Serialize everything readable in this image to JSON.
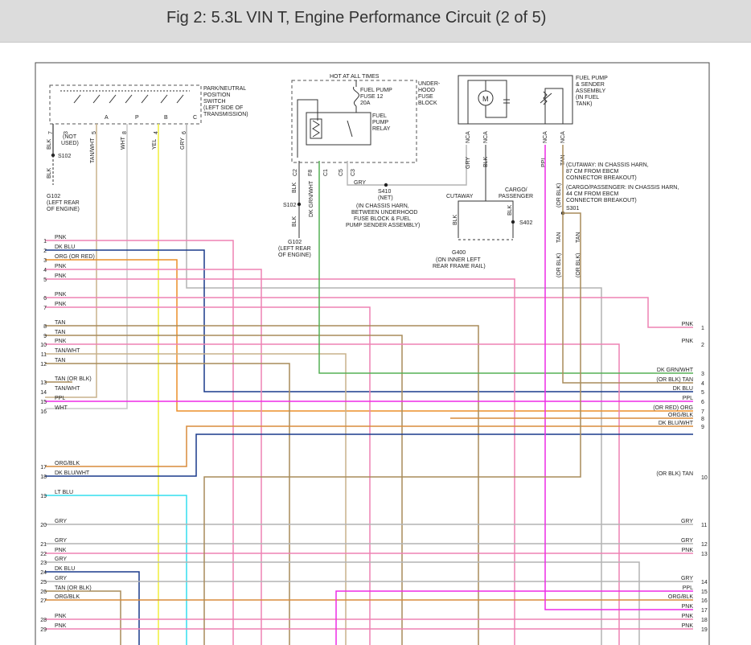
{
  "header": {
    "title": "Fig 2: 5.3L VIN T, Engine Performance Circuit (2 of 5)"
  },
  "colors": {
    "PNK": "#ee82b4",
    "DKBLU": "#1a3a8c",
    "ORG": "#ec8f2a",
    "TAN": "#a88c5a",
    "TANWHT": "#c8b28c",
    "PPL": "#ee2ce6",
    "WHT": "#c8c8c8",
    "GRY": "#b4b4b4",
    "YEL": "#f0ee3a",
    "DKGRNWHT": "#55b055",
    "LTBLU": "#33ddee",
    "ORGBLK": "#d88b3c",
    "BLK": "#333333",
    "BOX": "#4a4a4a"
  },
  "park_switch": {
    "title_lines": [
      "PARK/NEUTRAL",
      "POSITION",
      "SWITCH",
      "(LEFT SIDE OF",
      "TRANSMISSION)"
    ],
    "positions": [
      "A",
      "P",
      "B",
      "C"
    ],
    "pins": [
      "7",
      "3",
      "5",
      "8",
      "4",
      "6"
    ],
    "wires": [
      "BLK",
      "(NOT USED)",
      "TAN/WHT",
      "WHT",
      "YEL",
      "GRY"
    ],
    "not_used": [
      "(NOT",
      "USED)"
    ]
  },
  "ground_left": {
    "splice": "S102",
    "wire": "BLK",
    "ground": "G102",
    "ground_lines": [
      "(LEFT REAR",
      "OF ENGINE)"
    ]
  },
  "fuse_block": {
    "hot_label": "HOT AT ALL TIMES",
    "block_lines": [
      "UNDER-",
      "HOOD",
      "FUSE",
      "BLOCK"
    ],
    "fuse_lines": [
      "FUEL PUMP",
      "FUSE 12",
      "20A"
    ],
    "relay_lines": [
      "FUEL",
      "PUMP",
      "RELAY"
    ],
    "pins": [
      "C2",
      "F8",
      "C1",
      "C5",
      "C3"
    ],
    "wire_blk": "BLK",
    "wire_dkgrn": "DK GRN/WHT",
    "wire_gry": "GRY",
    "splice_s102": "S102",
    "wire_blk2": "BLK",
    "ground": "G102",
    "ground_lines": [
      "(LEFT REAR",
      "OF ENGINE)"
    ]
  },
  "s410": {
    "label": "S410",
    "sub": "(NET)",
    "lines": [
      "(IN CHASSIS HARN,",
      "BETWEEN UNDERHOOD",
      "FUSE BLOCK & FUEL",
      "PUMP SENDER ASSEMBLY)"
    ]
  },
  "fuel_pump": {
    "title_lines": [
      "FUEL PUMP",
      "& SENDER",
      "ASSEMBLY",
      "(IN FUEL",
      "TANK)"
    ],
    "motor": "M",
    "pins": [
      "NCA",
      "NCA",
      "NCA",
      "NCA"
    ],
    "wires": [
      "GRY",
      "BLK",
      "PPL",
      "TAN"
    ]
  },
  "ground_g400": {
    "cutaway": "CUTAWAY",
    "cargo_lines": [
      "CARGO/",
      "PASSENGER"
    ],
    "wire1": "BLK",
    "wire2": "BLK",
    "splice": "S402",
    "ground": "G400",
    "ground_lines": [
      "(ON INNER LEFT",
      "REAR FRAME RAIL)"
    ]
  },
  "s301": {
    "lines": [
      "(CUTAWAY: IN CHASSIS HARN,",
      "87 CM FROM EBCM",
      "CONNECTOR BREAKOUT)",
      "(CARGO/PASSENGER: IN CHASSIS HARN,",
      "44 CM FROM EBCM",
      "CONNECTOR BREAKOUT)"
    ],
    "splice": "S301",
    "orblk": "(OR BLK)",
    "tan": "TAN"
  },
  "left_rows": [
    {
      "n": "1",
      "w": "PNK"
    },
    {
      "n": "2",
      "w": "DK BLU"
    },
    {
      "n": "3",
      "w": "ORG  (OR RED)"
    },
    {
      "n": "4",
      "w": "PNK"
    },
    {
      "n": "5",
      "w": "PNK"
    },
    {
      "n": "6",
      "w": "PNK"
    },
    {
      "n": "7",
      "w": "PNK"
    },
    {
      "n": "8",
      "w": "TAN"
    },
    {
      "n": "9",
      "w": "TAN"
    },
    {
      "n": "10",
      "w": "PNK"
    },
    {
      "n": "11",
      "w": "TAN/WHT"
    },
    {
      "n": "12",
      "w": "TAN"
    },
    {
      "n": "13",
      "w": "TAN  (OR BLK)"
    },
    {
      "n": "14",
      "w": "TAN/WHT"
    },
    {
      "n": "15",
      "w": "PPL"
    },
    {
      "n": "16",
      "w": "WHT"
    },
    {
      "n": "17",
      "w": "ORG/BLK"
    },
    {
      "n": "18",
      "w": "DK BLU/WHT"
    },
    {
      "n": "19",
      "w": "LT BLU"
    },
    {
      "n": "20",
      "w": "GRY"
    },
    {
      "n": "21",
      "w": "GRY"
    },
    {
      "n": "22",
      "w": "PNK"
    },
    {
      "n": "23",
      "w": "GRY"
    },
    {
      "n": "24",
      "w": "DK BLU"
    },
    {
      "n": "25",
      "w": "GRY"
    },
    {
      "n": "26",
      "w": "TAN  (OR BLK)"
    },
    {
      "n": "27",
      "w": "ORG/BLK"
    },
    {
      "n": "28",
      "w": "PNK"
    },
    {
      "n": "29",
      "w": "PNK"
    }
  ],
  "right_rows": [
    {
      "n": "1",
      "w": "PNK"
    },
    {
      "n": "2",
      "w": "PNK"
    },
    {
      "n": "3",
      "w": "DK GRN/WHT"
    },
    {
      "n": "4",
      "w": "(OR BLK)  TAN"
    },
    {
      "n": "5",
      "w": "DK BLU"
    },
    {
      "n": "6",
      "w": "PPL"
    },
    {
      "n": "7",
      "w": "(OR RED)  ORG"
    },
    {
      "n": "8",
      "w": "ORG/BLK"
    },
    {
      "n": "9",
      "w": "DK BLU/WHT"
    },
    {
      "n": "10",
      "w": "(OR BLK)  TAN"
    },
    {
      "n": "11",
      "w": "GRY"
    },
    {
      "n": "12",
      "w": "GRY"
    },
    {
      "n": "13",
      "w": "PNK"
    },
    {
      "n": "14",
      "w": "GRY"
    },
    {
      "n": "15",
      "w": "PPL"
    },
    {
      "n": "16",
      "w": "ORG/BLK"
    },
    {
      "n": "17",
      "w": "PNK"
    },
    {
      "n": "18",
      "w": "PNK"
    },
    {
      "n": "19",
      "w": "PNK"
    }
  ]
}
